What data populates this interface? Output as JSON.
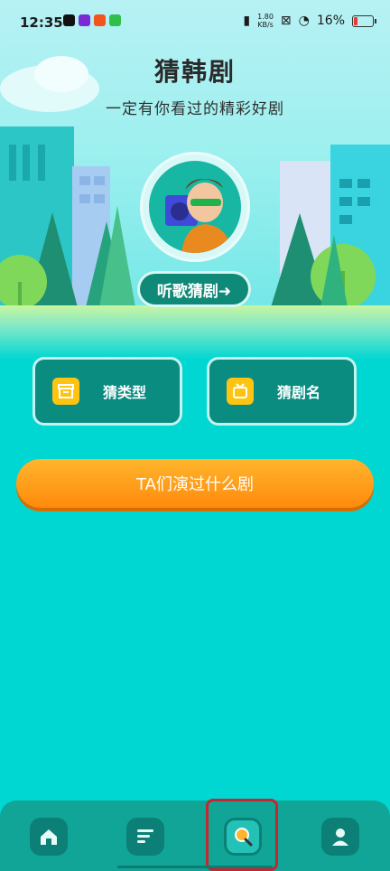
{
  "status_bar": {
    "time": "12:35",
    "net_speed_value": "1.80",
    "net_speed_unit": "KB/s",
    "battery": "16%"
  },
  "header": {
    "title": "猜韩剧",
    "subtitle": "一定有你看过的精彩好剧"
  },
  "hero": {
    "listen_button": "听歌猜剧➜"
  },
  "options": {
    "guess_type": "猜类型",
    "guess_title": "猜剧名"
  },
  "cta": {
    "label": "TA们演过什么剧"
  },
  "tabs": [
    {
      "icon": "home-icon",
      "active": false
    },
    {
      "icon": "list-icon",
      "active": false
    },
    {
      "icon": "search-icon",
      "active": true
    },
    {
      "icon": "profile-icon",
      "active": false
    }
  ],
  "colors": {
    "background": "#00d6d2",
    "card": "#0b8c81",
    "accent_yellow": "#ffc412",
    "cta_orange": "#ff8a0d",
    "tabbar": "#11a597",
    "highlight": "#c6262e"
  }
}
